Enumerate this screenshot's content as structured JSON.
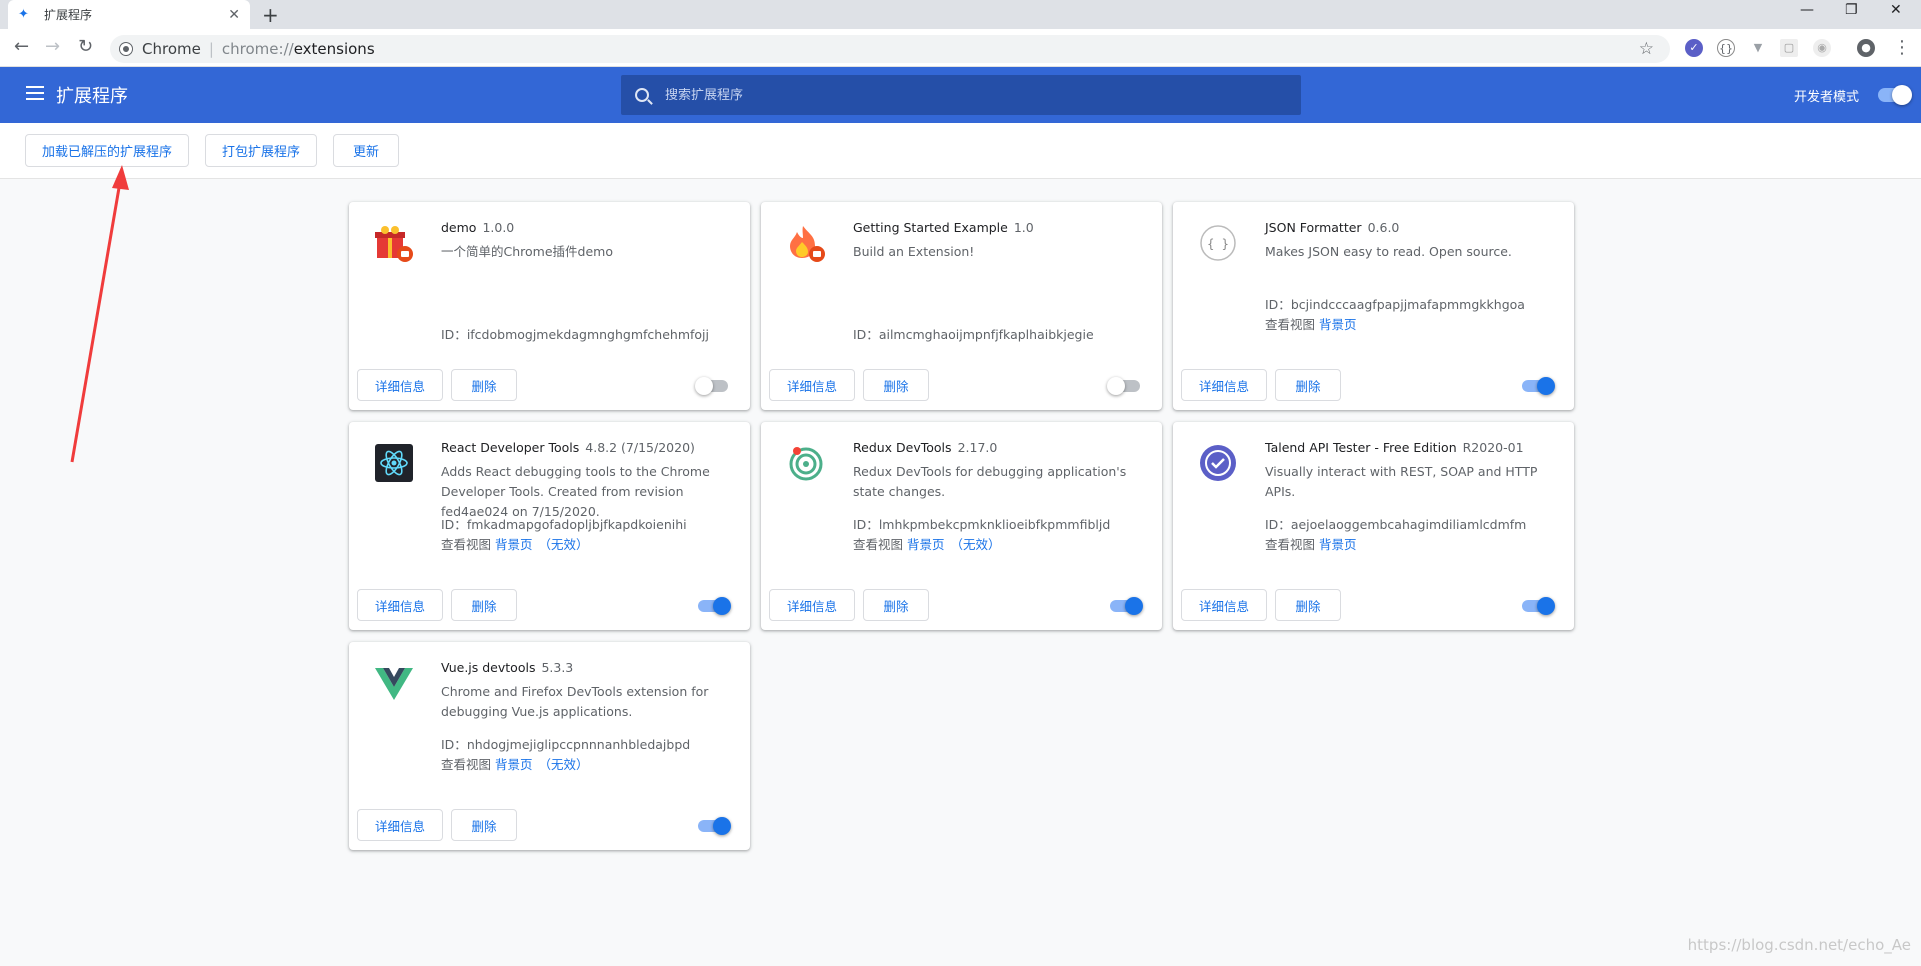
{
  "browser": {
    "tab_title": "扩展程序",
    "tab_close": "✕",
    "new_tab": "+",
    "window_controls": [
      "—",
      "❐",
      "✕"
    ],
    "back": "←",
    "forward": "→",
    "reload": "↻",
    "omnibox_chip": "Chrome",
    "url_scheme": "chrome://",
    "url_path": "extensions",
    "bookmark_star": "☆",
    "menu_dots": "⋮"
  },
  "header": {
    "title": "扩展程序",
    "search_placeholder": "搜索扩展程序",
    "dev_mode_label": "开发者模式",
    "dev_mode_on": true
  },
  "actions": {
    "load_unpacked": "加载已解压的扩展程序",
    "pack": "打包扩展程序",
    "update": "更新"
  },
  "labels": {
    "details": "详细信息",
    "remove": "删除",
    "view": "查看视图",
    "background_page": "背景页",
    "inactive": "（无效）",
    "id_prefix": "ID："
  },
  "extensions": [
    {
      "name": "demo",
      "version": "1.0.0",
      "description": "一个简单的Chrome插件demo",
      "id": "ifcdobmogjmekdagmnghgmfchehmfojj",
      "enabled": false,
      "icon": "gift-icon",
      "views": false
    },
    {
      "name": "Getting Started Example",
      "version": "1.0",
      "description": "Build an Extension!",
      "id": "ailmcmghaoijmpnfjfkaplhaibkjegie",
      "enabled": false,
      "icon": "flame-icon",
      "views": false
    },
    {
      "name": "JSON Formatter",
      "version": "0.6.0",
      "description": "Makes JSON easy to read. Open source.",
      "id": "bcjindcccaagfpapjjmafapmmgkkhgoa",
      "enabled": true,
      "icon": "json-icon",
      "views": true
    },
    {
      "name": "React Developer Tools",
      "version": "4.8.2 (7/15/2020)",
      "description": "Adds React debugging tools to the Chrome Developer Tools. Created from revision fed4ae024 on 7/15/2020.",
      "id": "fmkadmapgofadopljbjfkapdkoienihi",
      "enabled": true,
      "icon": "react-icon",
      "views": true,
      "inactive": true
    },
    {
      "name": "Redux DevTools",
      "version": "2.17.0",
      "description": "Redux DevTools for debugging application's state changes.",
      "id": "lmhkpmbekcpmknklioeibfkpmmfibljd",
      "enabled": true,
      "icon": "redux-icon",
      "views": true,
      "inactive": true
    },
    {
      "name": "Talend API Tester - Free Edition",
      "version": "R2020-01",
      "description": "Visually interact with REST, SOAP and HTTP APIs.",
      "id": "aejoelaoggembcahagimdiliamlcdmfm",
      "enabled": true,
      "icon": "talend-icon",
      "views": true
    },
    {
      "name": "Vue.js devtools",
      "version": "5.3.3",
      "description": "Chrome and Firefox DevTools extension for debugging Vue.js applications.",
      "id": "nhdogjmejiglipccpnnnanhbledajbpd",
      "enabled": true,
      "icon": "vue-icon",
      "views": true,
      "inactive": true
    }
  ],
  "watermark": "https://blog.csdn.net/echo_Ae"
}
